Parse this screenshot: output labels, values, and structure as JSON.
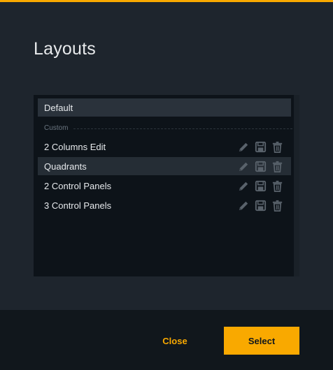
{
  "dialog": {
    "title": "Layouts",
    "accent_color": "#f9a900"
  },
  "layouts": {
    "default_item": "Default",
    "section_label": "Custom",
    "items": [
      {
        "label": "2 Columns Edit",
        "selected": false,
        "actions": [
          "pencil-icon",
          "save-icon",
          "trash-icon"
        ]
      },
      {
        "label": "Quadrants",
        "selected": true,
        "actions": [
          "pencil-icon",
          "save-icon",
          "trash-icon"
        ]
      },
      {
        "label": "2 Control Panels",
        "selected": false,
        "actions": [
          "pencil-icon",
          "save-icon",
          "trash-icon"
        ]
      },
      {
        "label": "3 Control Panels",
        "selected": false,
        "actions": [
          "pencil-icon",
          "save-icon",
          "trash-icon"
        ]
      }
    ]
  },
  "footer": {
    "close_label": "Close",
    "select_label": "Select"
  }
}
